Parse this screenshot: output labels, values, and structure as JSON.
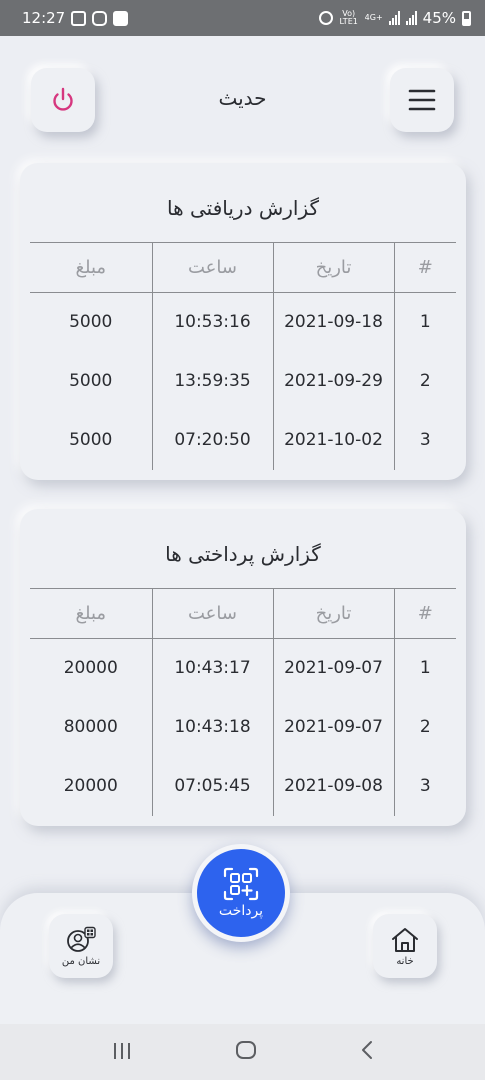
{
  "status_bar": {
    "time": "12:27",
    "battery": "45%",
    "network_label": "Vo) LTE1",
    "network_type": "4G+"
  },
  "header": {
    "title": "حدیث"
  },
  "received_report": {
    "title": "گزارش دریافتی ها",
    "columns": [
      "#",
      "تاریخ",
      "ساعت",
      "مبلغ"
    ],
    "rows": [
      {
        "num": "1",
        "date": "2021-09-18",
        "time": "10:53:16",
        "amount": "5000"
      },
      {
        "num": "2",
        "date": "2021-09-29",
        "time": "13:59:35",
        "amount": "5000"
      },
      {
        "num": "3",
        "date": "2021-10-02",
        "time": "07:20:50",
        "amount": "5000"
      }
    ]
  },
  "paid_report": {
    "title": "گزارش پرداختی ها",
    "columns": [
      "#",
      "تاریخ",
      "ساعت",
      "مبلغ"
    ],
    "rows": [
      {
        "num": "1",
        "date": "2021-09-07",
        "time": "10:43:17",
        "amount": "20000"
      },
      {
        "num": "2",
        "date": "2021-09-07",
        "time": "10:43:18",
        "amount": "80000"
      },
      {
        "num": "3",
        "date": "2021-09-08",
        "time": "07:05:45",
        "amount": "20000"
      }
    ]
  },
  "bottom_nav": {
    "pay_label": "پرداخت",
    "my_badge_label": "نشان من",
    "home_label": "خانه"
  },
  "colors": {
    "accent": "#2d63ee",
    "power": "#d6377f",
    "background": "#eceef3"
  },
  "icons": {
    "power": "power-icon",
    "menu": "hamburger-menu-icon",
    "pay": "qr-scan-icon",
    "my_badge": "user-qr-icon",
    "home": "home-icon"
  }
}
